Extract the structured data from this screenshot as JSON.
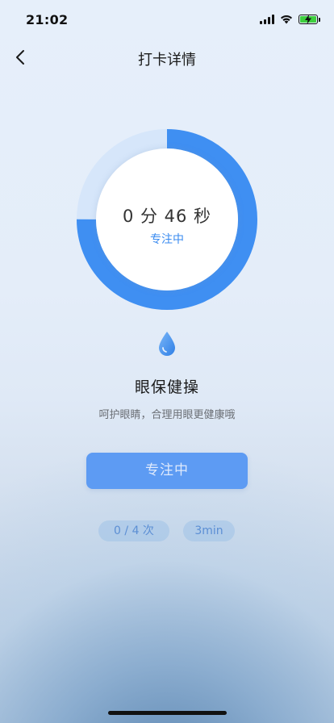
{
  "status_bar": {
    "time": "21:02",
    "battery_charging": true
  },
  "nav": {
    "title": "打卡详情",
    "back_icon": "chevron-left-icon"
  },
  "timer": {
    "display": "0 分 46 秒",
    "status": "专注中",
    "progress": 0.75
  },
  "activity": {
    "icon": "water-drop-icon",
    "title": "眼保健操",
    "description": "呵护眼睛，合理用眼更健康哦"
  },
  "action_button": {
    "label": "专注中"
  },
  "stats": {
    "count": "0 / 4 次",
    "duration": "3min"
  },
  "colors": {
    "accent": "#3a8bf0",
    "ring_track": "#d6e6fa",
    "button": "#5d9bf3"
  }
}
